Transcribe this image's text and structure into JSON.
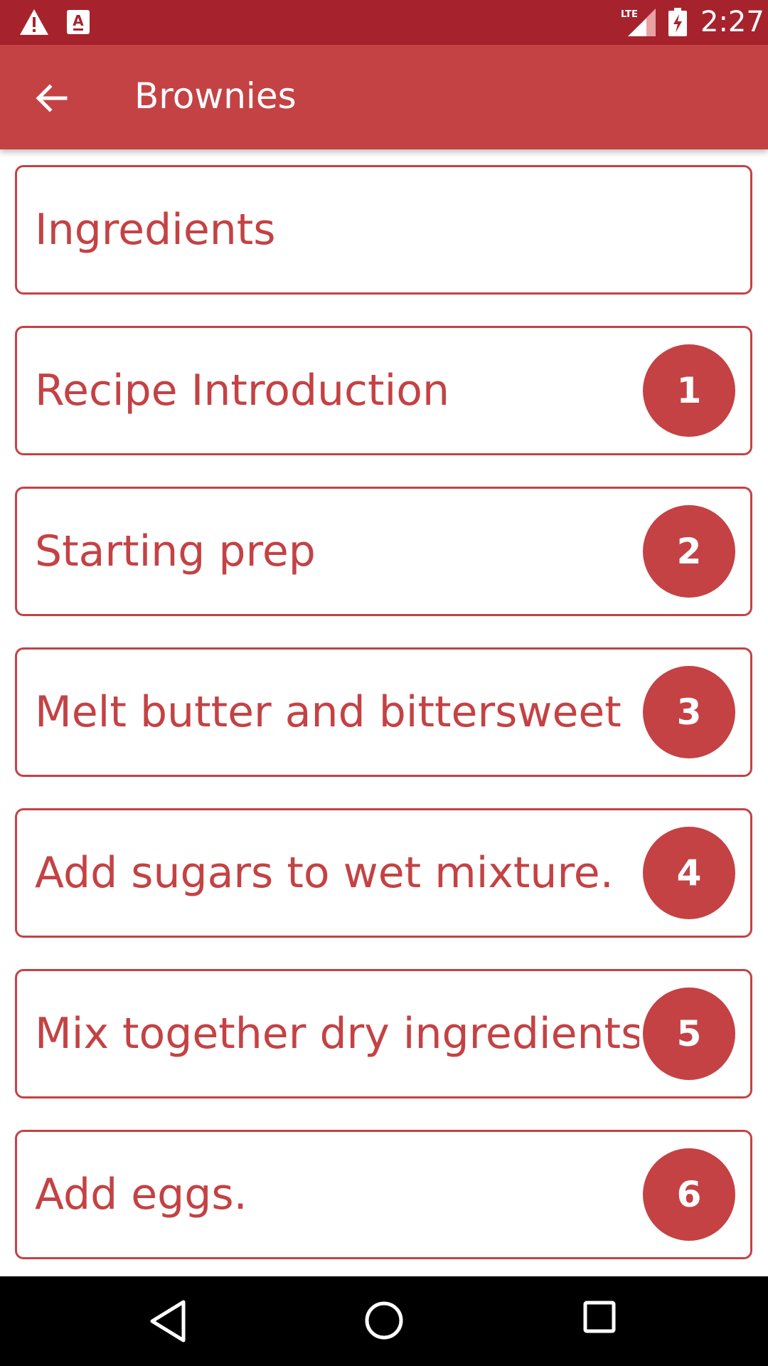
{
  "status_bar": {
    "network": "LTE",
    "time": "2:27",
    "icons": [
      "warning-icon",
      "text-a-icon",
      "lte-signal-icon",
      "battery-charging-icon"
    ]
  },
  "app_bar": {
    "back_icon": "arrow-left-icon",
    "title": "Brownies"
  },
  "list": {
    "items": [
      {
        "label": "Ingredients",
        "step": ""
      },
      {
        "label": "Recipe Introduction",
        "step": "1"
      },
      {
        "label": "Starting prep",
        "step": "2"
      },
      {
        "label": "Melt butter and bittersweet …",
        "step": "3"
      },
      {
        "label": "Add sugars to wet mixture.",
        "step": "4"
      },
      {
        "label": "Mix together dry ingredients.",
        "step": "5"
      },
      {
        "label": "Add eggs.",
        "step": "6"
      }
    ]
  },
  "nav_bar": {
    "icons": [
      "nav-back-icon",
      "nav-home-icon",
      "nav-recents-icon"
    ]
  },
  "colors": {
    "status_bar": "#a6232d",
    "primary": "#c44244",
    "nav_bar": "#000000"
  }
}
